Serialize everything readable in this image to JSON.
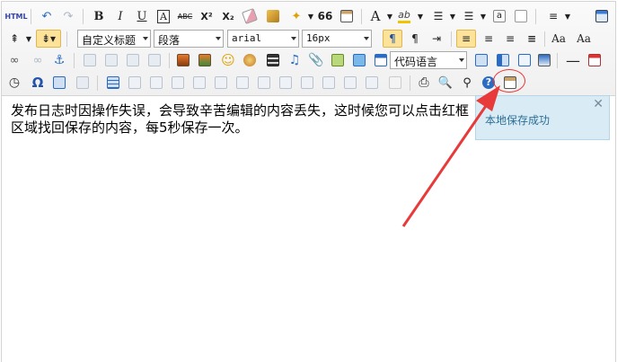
{
  "toolbar": {
    "html_label": "HTML",
    "bold": "B",
    "italic": "I",
    "underline": "U",
    "strike": "ABC",
    "superscript": "X²",
    "subscript": "X₂",
    "quote_mark": "66",
    "custom_heading": "自定义标题",
    "paragraph": "段落",
    "font_family": "arial",
    "font_size": "16px",
    "code_language": "代码语言",
    "omega": "Ω",
    "omega_color": "#2255aa"
  },
  "content": {
    "text": "发布日志时因操作失误，会导致辛苦编辑的内容丢失，这时候您可以点击红框区域找回保存的内容，每5秒保存一次。"
  },
  "notice": {
    "message": "本地保存成功",
    "close": "✕"
  },
  "colors": {
    "highlight_circle": "#e33333",
    "arrow": "#e83a3a",
    "notice_bg": "#d9ecf6",
    "active_bg": "#fde39a"
  }
}
